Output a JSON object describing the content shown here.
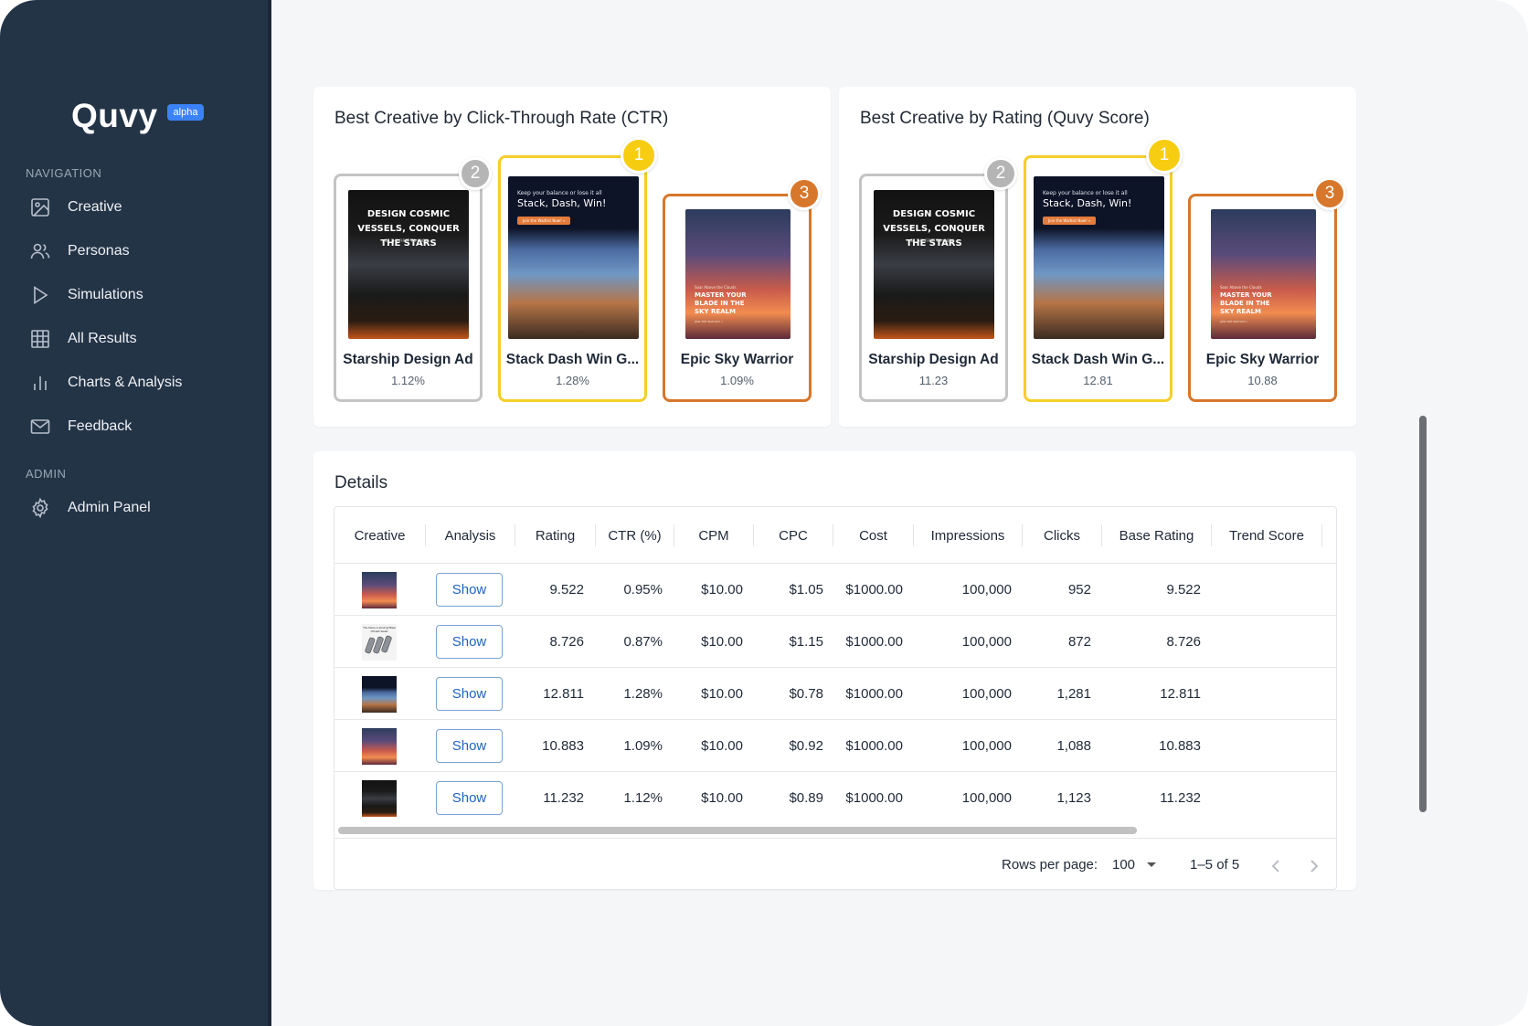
{
  "brand": {
    "name": "Quvy",
    "badge": "alpha"
  },
  "nav": {
    "section_navigation": "NAVIGATION",
    "section_admin": "ADMIN",
    "items": [
      {
        "label": "Creative",
        "icon": "image-icon"
      },
      {
        "label": "Personas",
        "icon": "users-icon"
      },
      {
        "label": "Simulations",
        "icon": "play-icon"
      },
      {
        "label": "All Results",
        "icon": "grid-icon"
      },
      {
        "label": "Charts & Analysis",
        "icon": "bar-chart-icon"
      },
      {
        "label": "Feedback",
        "icon": "mail-icon"
      }
    ],
    "admin_items": [
      {
        "label": "Admin Panel",
        "icon": "gear-icon"
      }
    ]
  },
  "ctr_card": {
    "title": "Best Creative by Click-Through Rate (CTR)",
    "tiles": [
      {
        "rank": "2",
        "name": "Starship Design Ad",
        "metric": "1.12%"
      },
      {
        "rank": "1",
        "name": "Stack Dash Win G...",
        "metric": "1.28%"
      },
      {
        "rank": "3",
        "name": "Epic Sky Warrior",
        "metric": "1.09%"
      }
    ]
  },
  "rating_card": {
    "title": "Best Creative by Rating (Quvy Score)",
    "tiles": [
      {
        "rank": "2",
        "name": "Starship Design Ad",
        "metric": "11.23"
      },
      {
        "rank": "1",
        "name": "Stack Dash Win G...",
        "metric": "12.81"
      },
      {
        "rank": "3",
        "name": "Epic Sky Warrior",
        "metric": "10.88"
      }
    ]
  },
  "art": {
    "starship_headline": "DESIGN COSMIC VESSELS, CONQUER THE STARS",
    "starship_sub": "BE THE FIRST TO KNOW »",
    "stack_top": "Keep your balance or lose it all",
    "stack_headline": "Stack, Dash, Win!",
    "stack_cta": "Join the Waitlist Now! »",
    "sky_top": "Soar Above the Clouds",
    "sky_headline": "MASTER YOUR BLADE IN THE SKY REALM",
    "sky_cta": "JOIN THE WAITLIST »",
    "bottles_headline": "The future is arriving! Blast Off with Soda!"
  },
  "details": {
    "title": "Details",
    "columns": [
      "Creative",
      "Analysis",
      "Rating",
      "CTR (%)",
      "CPM",
      "CPC",
      "Cost",
      "Impressions",
      "Clicks",
      "Base Rating",
      "Trend Score"
    ],
    "rows": [
      {
        "thumb": "sky",
        "action": "Show",
        "rating": "9.522",
        "ctr": "0.95%",
        "cpm": "$10.00",
        "cpc": "$1.05",
        "cost": "$1000.00",
        "impressions": "100,000",
        "clicks": "952",
        "base_rating": "9.522",
        "trend_score": ""
      },
      {
        "thumb": "bottles",
        "action": "Show",
        "rating": "8.726",
        "ctr": "0.87%",
        "cpm": "$10.00",
        "cpc": "$1.15",
        "cost": "$1000.00",
        "impressions": "100,000",
        "clicks": "872",
        "base_rating": "8.726",
        "trend_score": ""
      },
      {
        "thumb": "stack",
        "action": "Show",
        "rating": "12.811",
        "ctr": "1.28%",
        "cpm": "$10.00",
        "cpc": "$0.78",
        "cost": "$1000.00",
        "impressions": "100,000",
        "clicks": "1,281",
        "base_rating": "12.811",
        "trend_score": ""
      },
      {
        "thumb": "sky",
        "action": "Show",
        "rating": "10.883",
        "ctr": "1.09%",
        "cpm": "$10.00",
        "cpc": "$0.92",
        "cost": "$1000.00",
        "impressions": "100,000",
        "clicks": "1,088",
        "base_rating": "10.883",
        "trend_score": ""
      },
      {
        "thumb": "starship",
        "action": "Show",
        "rating": "11.232",
        "ctr": "1.12%",
        "cpm": "$10.00",
        "cpc": "$0.89",
        "cost": "$1000.00",
        "impressions": "100,000",
        "clicks": "1,123",
        "base_rating": "11.232",
        "trend_score": ""
      }
    ],
    "pagination": {
      "rows_per_page_label": "Rows per page:",
      "rows_per_page_value": "100",
      "range": "1–5 of 5"
    }
  },
  "colors": {
    "sidebar": "#243447",
    "gold": "#f7cd12",
    "silver": "#b5b5b5",
    "bronze": "#d7772c",
    "link": "#1e64c0"
  }
}
